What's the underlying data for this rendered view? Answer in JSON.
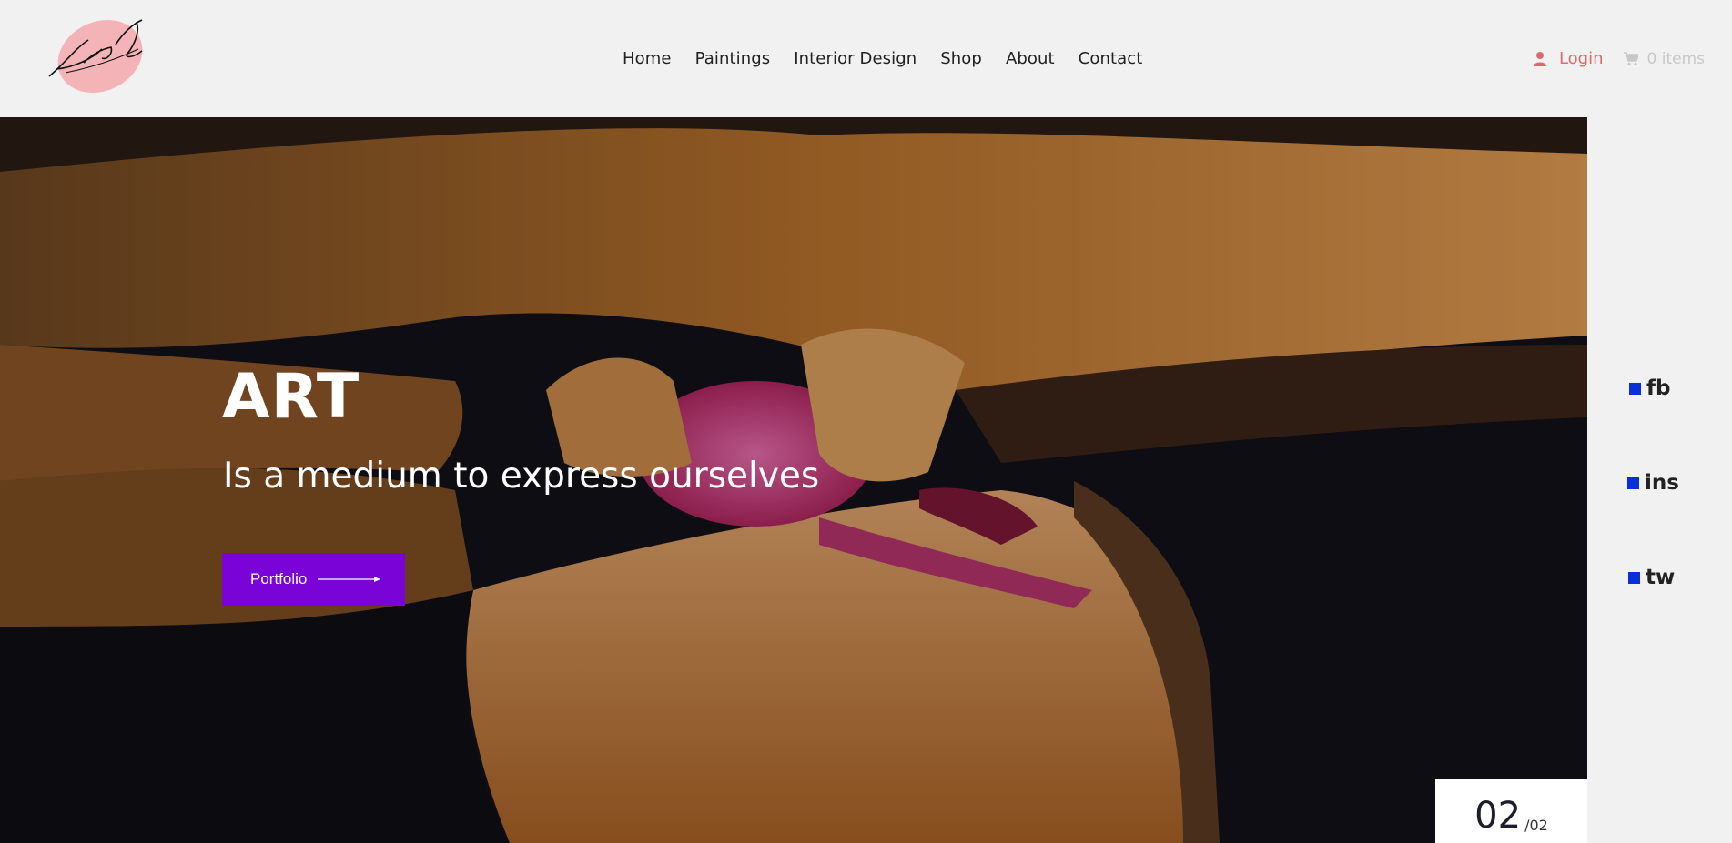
{
  "header": {
    "nav": [
      "Home",
      "Paintings",
      "Interior Design",
      "Shop",
      "About",
      "Contact"
    ],
    "login_label": "Login",
    "cart_label": "0 items"
  },
  "hero": {
    "title": "ART",
    "subtitle": "Is a medium to express ourselves",
    "button_label": "Portfolio",
    "slide_current": "02",
    "slide_total": "/02"
  },
  "social": [
    {
      "label": "fb",
      "icon": "facebook-icon"
    },
    {
      "label": "ins",
      "icon": "instagram-icon"
    },
    {
      "label": "tw",
      "icon": "twitter-icon"
    }
  ],
  "colors": {
    "accent": "#7a04d8",
    "login": "#d96b6b",
    "social_square": "#0a2ed8",
    "logo_blob": "#f4b3b6"
  }
}
